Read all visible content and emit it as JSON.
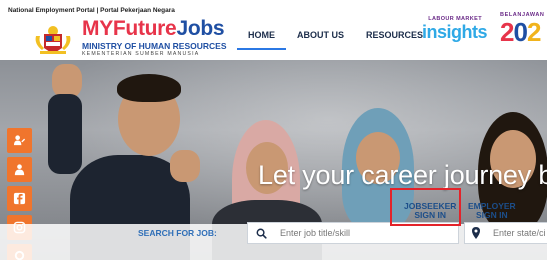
{
  "header": {
    "portal_line": "National Employment Portal | Portal Pekerjaan Negara",
    "brand_my": "MY",
    "brand_future": "Future",
    "brand_jobs": "Jobs",
    "brand_ministry": "MINISTRY OF HUMAN RESOURCES",
    "brand_ministry_malay": "KEMENTERIAN SUMBER MANUSIA",
    "nav": [
      {
        "label": "HOME",
        "active": true
      },
      {
        "label": "ABOUT US",
        "active": false
      },
      {
        "label": "RESOURCES",
        "active": false
      }
    ],
    "insights_top": "LABOUR MARKET",
    "insights_word": "insights",
    "belanjawan_label": "BELANJAWAN",
    "belanjawan_year": "202"
  },
  "hero": {
    "tagline": "Let your career journey b"
  },
  "social": [
    {
      "name": "jobseeker-profile-icon"
    },
    {
      "name": "employer-icon"
    },
    {
      "name": "facebook-icon"
    },
    {
      "name": "instagram-icon"
    },
    {
      "name": "location-icon"
    }
  ],
  "search": {
    "label": "SEARCH FOR JOB:",
    "job_placeholder": "Enter job title/skill",
    "location_placeholder": "Enter state/ci"
  },
  "signin": {
    "jobseeker_line1": "JOBSEEKER",
    "jobseeker_line2": "SIGN IN",
    "employer_line1": "EMPLOYER",
    "employer_line2": "SIGN IN"
  },
  "colors": {
    "accent_orange": "#f0752d",
    "brand_red": "#e7344a",
    "brand_blue": "#1f4fa3",
    "highlight_red": "#e3232a"
  }
}
